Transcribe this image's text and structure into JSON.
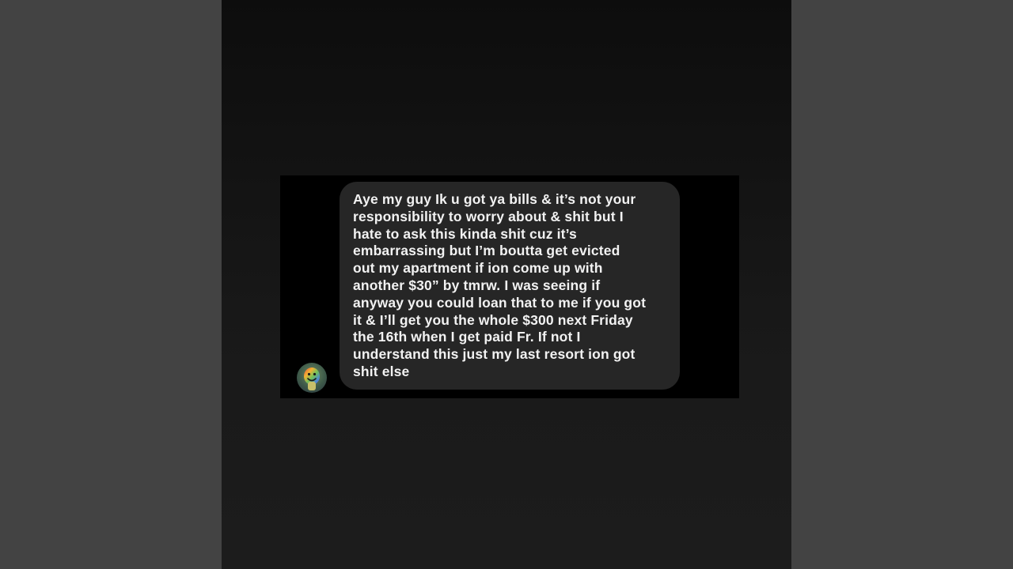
{
  "message": {
    "text": "Aye my guy Ik u got ya bills & it’s not your\nresponsibility to worry about & shit but I\nhate to ask this kinda shit cuz it’s\nembarrassing but I’m boutta get evicted\nout my apartment if ion come up with\nanother $30” by tmrw. I was seeing if\nanyway you could loan that to me if you got\nit & I’ll get you the whole $300 next Friday\nthe 16th when I get paid Fr. If not I\nunderstand this just my last resort ion got\nshit else",
    "direction": "incoming"
  },
  "sender": {
    "avatar_icon": "smiley-face-avatar-icon"
  },
  "colors": {
    "outer_background": "#434343",
    "panel_background": "#141414",
    "screenshot_background": "#000000",
    "bubble_background": "#262626",
    "text": "#f2f2f2"
  }
}
